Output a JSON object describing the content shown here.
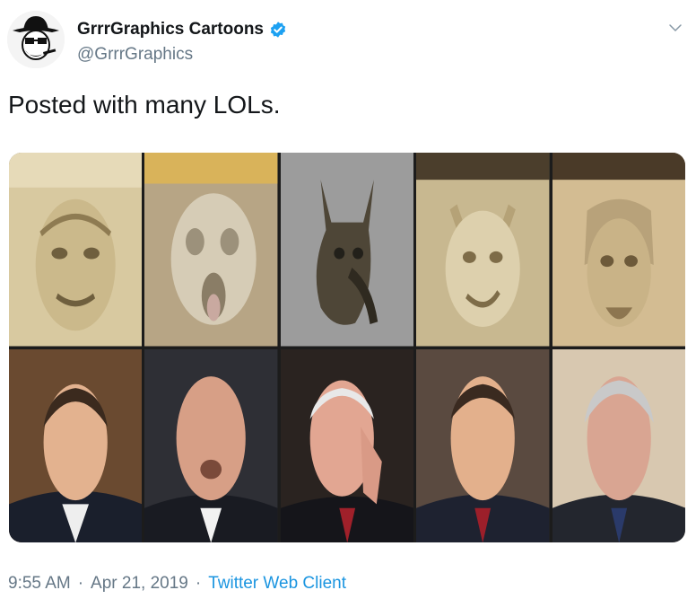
{
  "author": {
    "display_name": "GrrrGraphics Cartoons",
    "handle": "@GrrrGraphics",
    "verified": true,
    "avatar_icon": "cartoon-cowboy-avatar-icon"
  },
  "tweet": {
    "text": "Posted with many LOLs."
  },
  "media": {
    "top_row_icons": [
      "gargoyle-face-1",
      "gargoyle-face-2",
      "gargoyle-face-3",
      "gargoyle-face-4",
      "gargoyle-face-5"
    ],
    "bottom_row_icons": [
      "portrait-1",
      "portrait-2",
      "portrait-3",
      "portrait-4",
      "portrait-5"
    ]
  },
  "meta": {
    "time": "9:55 AM",
    "separator": "·",
    "date": "Apr 21, 2019",
    "client": "Twitter Web Client"
  },
  "colors": {
    "link": "#1b95e0",
    "verified_badge": "#1da1f2",
    "secondary_text": "#657786"
  }
}
